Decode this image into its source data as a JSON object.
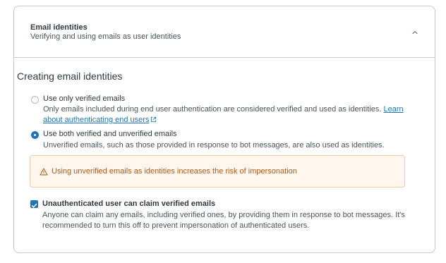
{
  "section": {
    "title": "Email identities",
    "subtitle": "Verifying and using emails as user identities",
    "expanded": true,
    "toggle_icon": "chevron-up-icon"
  },
  "creating": {
    "heading": "Creating email identities",
    "options": [
      {
        "label": "Use only verified emails",
        "hint": "Only emails included during end user authentication are considered verified and used as identities.",
        "link_text": "Learn about authenticating end users",
        "selected": false
      },
      {
        "label": "Use both verified and unverified emails",
        "hint": "Unverified emails, such as those provided in response to bot messages, are also used as identities.",
        "selected": true
      }
    ],
    "warning": {
      "icon": "warning-icon",
      "text": "Using unverified emails as identities increases the risk of impersonation",
      "color": "#ad5918",
      "background": "#fff7ed"
    },
    "claim": {
      "label": "Unauthenticated user can claim verified emails",
      "hint": "Anyone can claim any emails, including verified ones, by providing them in response to bot messages. It's recommended to turn this off to prevent impersonation of authenticated users.",
      "checked": true
    }
  },
  "colors": {
    "accent": "#1f73b7",
    "border": "#c2c8cc",
    "text": "#2f3941",
    "muted": "#49545c"
  }
}
